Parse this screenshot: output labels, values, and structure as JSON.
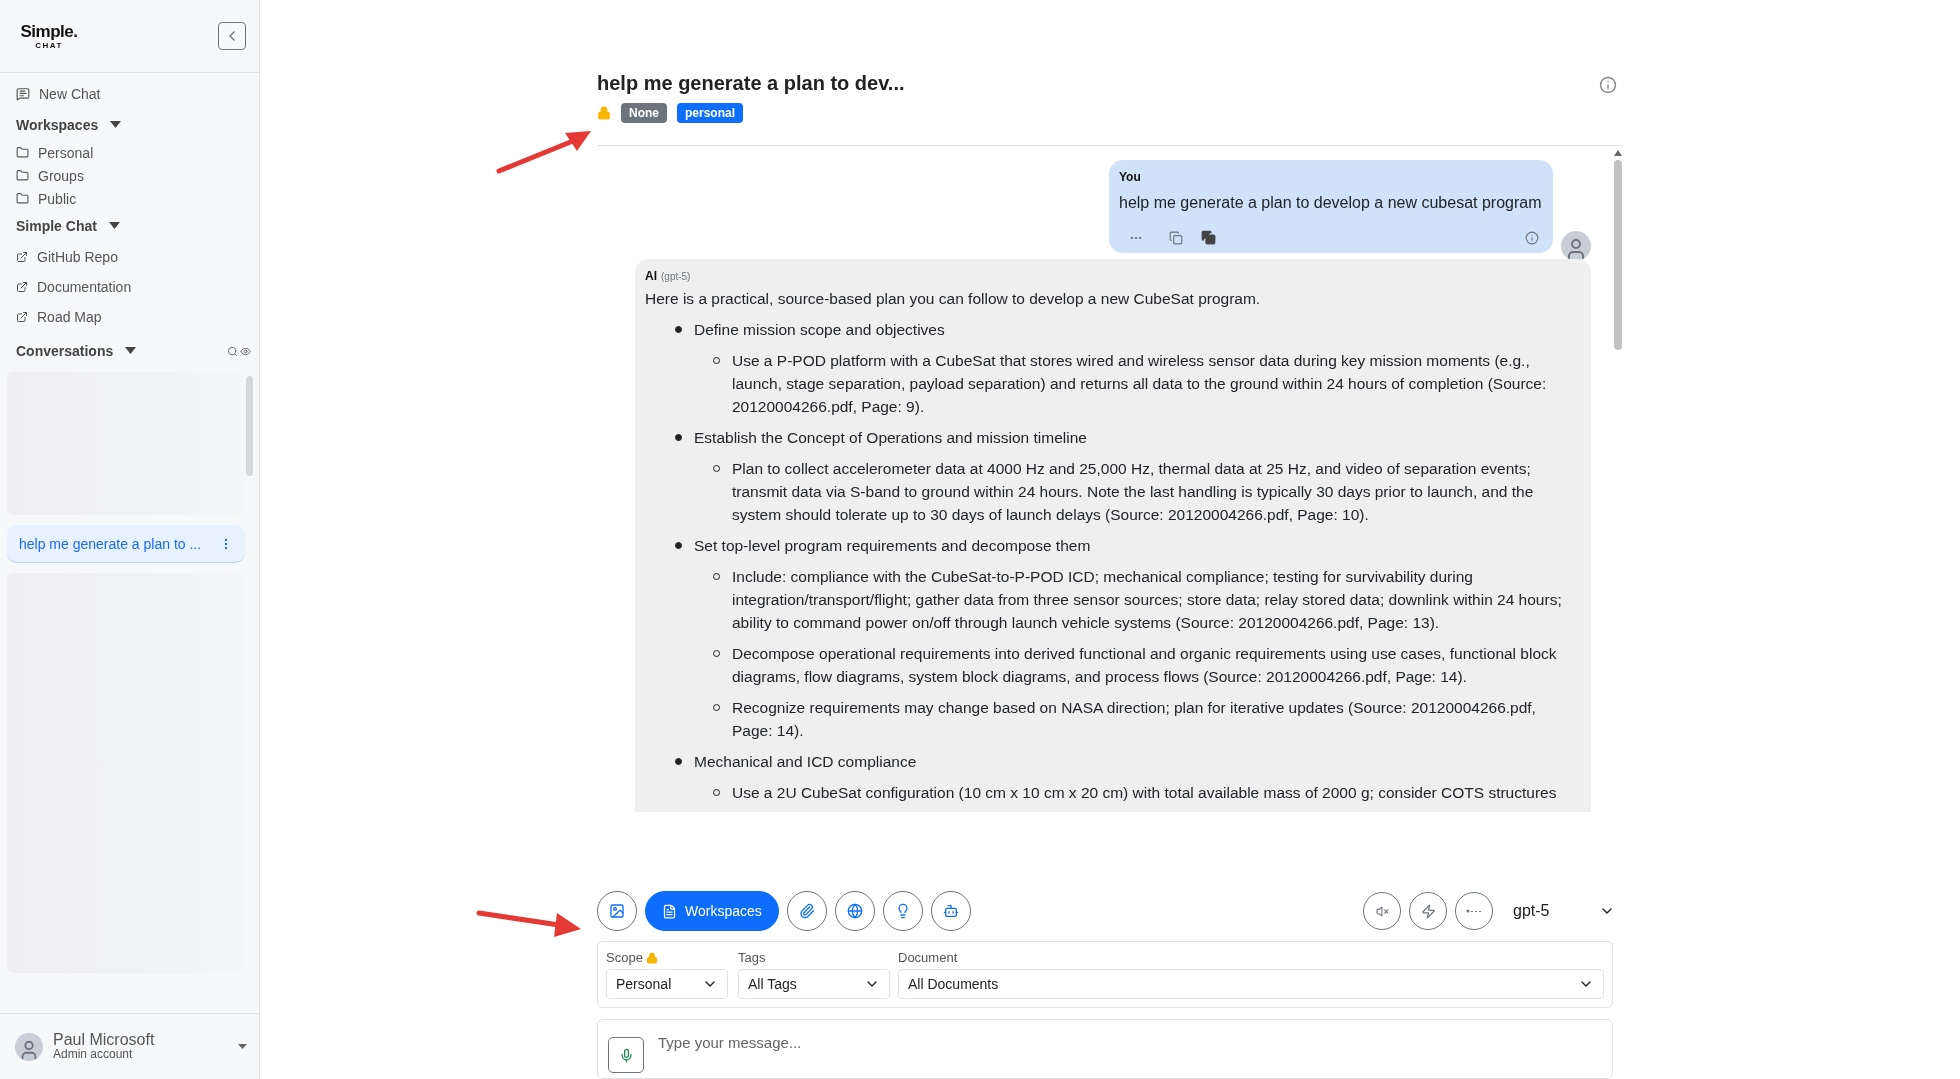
{
  "sidebar": {
    "logo": {
      "name": "Simple.",
      "sub": "CHAT"
    },
    "new_chat": "New Chat",
    "sections": [
      {
        "title": "Workspaces",
        "items": [
          {
            "label": "Personal",
            "kind": "folder"
          },
          {
            "label": "Groups",
            "kind": "folder"
          },
          {
            "label": "Public",
            "kind": "folder"
          }
        ]
      },
      {
        "title": "Simple Chat",
        "items": [
          {
            "label": "GitHub Repo",
            "kind": "link"
          },
          {
            "label": "Documentation",
            "kind": "link"
          },
          {
            "label": "Road Map",
            "kind": "link"
          }
        ]
      }
    ],
    "conversations": {
      "title": "Conversations",
      "items": [
        {
          "kind": "blurred"
        },
        {
          "kind": "chat",
          "label": "help me generate a plan to ...",
          "selected": true
        },
        {
          "kind": "blurred"
        }
      ]
    },
    "user": {
      "name": "Paul Microsoft",
      "role": "Admin account"
    }
  },
  "chat": {
    "title": "help me generate a plan to dev...",
    "locked": true,
    "tags": [
      {
        "label": "None",
        "color": "#6c757d"
      },
      {
        "label": "personal",
        "color": "#0d6efd"
      }
    ]
  },
  "messages": [
    {
      "kind": "user",
      "sender": "You",
      "text": "help me generate a plan to develop a new cubesat program"
    },
    {
      "kind": "ai",
      "sender": "AI",
      "model": "(gpt-5)",
      "intro": "Here is a practical, source-based plan you can follow to develop a new CubeSat program.",
      "bullets": [
        {
          "text": "Define mission scope and objectives",
          "children": [
            {
              "text": "Use a P-POD platform with a CubeSat that stores wired and wireless sensor data during key mission moments (e.g., launch, stage separation, payload separation) and returns all data to the ground within 24 hours of completion (Source: 20120004266.pdf, Page: 9)."
            }
          ]
        },
        {
          "text": "Establish the Concept of Operations and mission timeline",
          "children": [
            {
              "text": "Plan to collect accelerometer data at 4000 Hz and 25,000 Hz, thermal data at 25 Hz, and video of separation events; transmit data via S-band to ground within 24 hours. Note the last handling is typically 30 days prior to launch, and the system should tolerate up to 30 days of launch delays (Source: 20120004266.pdf, Page: 10)."
            }
          ]
        },
        {
          "text": "Set top-level program requirements and decompose them",
          "children": [
            {
              "text": "Include: compliance with the CubeSat-to-P-POD ICD; mechanical compliance; testing for survivability during integration/transport/flight; gather data from three sensor sources; store data; relay stored data; downlink within 24 hours; ability to command power on/off through launch vehicle systems (Source: 20120004266.pdf, Page: 13)."
            },
            {
              "text": "Decompose operational requirements into derived functional and organic requirements using use cases, functional block diagrams, flow diagrams, system block diagrams, and process flows (Source: 20120004266.pdf, Page: 14)."
            },
            {
              "text": "Recognize requirements may change based on NASA direction; plan for iterative updates (Source: 20120004266.pdf, Page: 14)."
            }
          ]
        },
        {
          "text": "Mechanical and ICD compliance",
          "children": [
            {
              "text": "Use a 2U CubeSat configuration (10 cm x 10 cm x 20 cm) with total available mass of 2000 g; consider COTS structures"
            }
          ]
        }
      ]
    }
  ],
  "toolbar": {
    "left": [
      {
        "kind": "image",
        "selected": false
      },
      {
        "kind": "workspaces",
        "label": "Workspaces",
        "selected": true
      },
      {
        "kind": "attach",
        "selected": false
      },
      {
        "kind": "web",
        "selected": false
      },
      {
        "kind": "idea",
        "selected": false
      },
      {
        "kind": "agent",
        "selected": false
      }
    ],
    "right": [
      {
        "kind": "mute"
      },
      {
        "kind": "flash"
      },
      {
        "kind": "dots"
      }
    ],
    "model": "gpt-5"
  },
  "scope": [
    {
      "label": "Scope",
      "locked": true,
      "value": "Personal",
      "kind": "small"
    },
    {
      "label": "Tags",
      "locked": false,
      "value": "All Tags",
      "kind": "medium"
    },
    {
      "label": "Document",
      "locked": false,
      "value": "All Documents",
      "kind": "wide"
    }
  ],
  "composer": {
    "placeholder": "Type your message..."
  }
}
